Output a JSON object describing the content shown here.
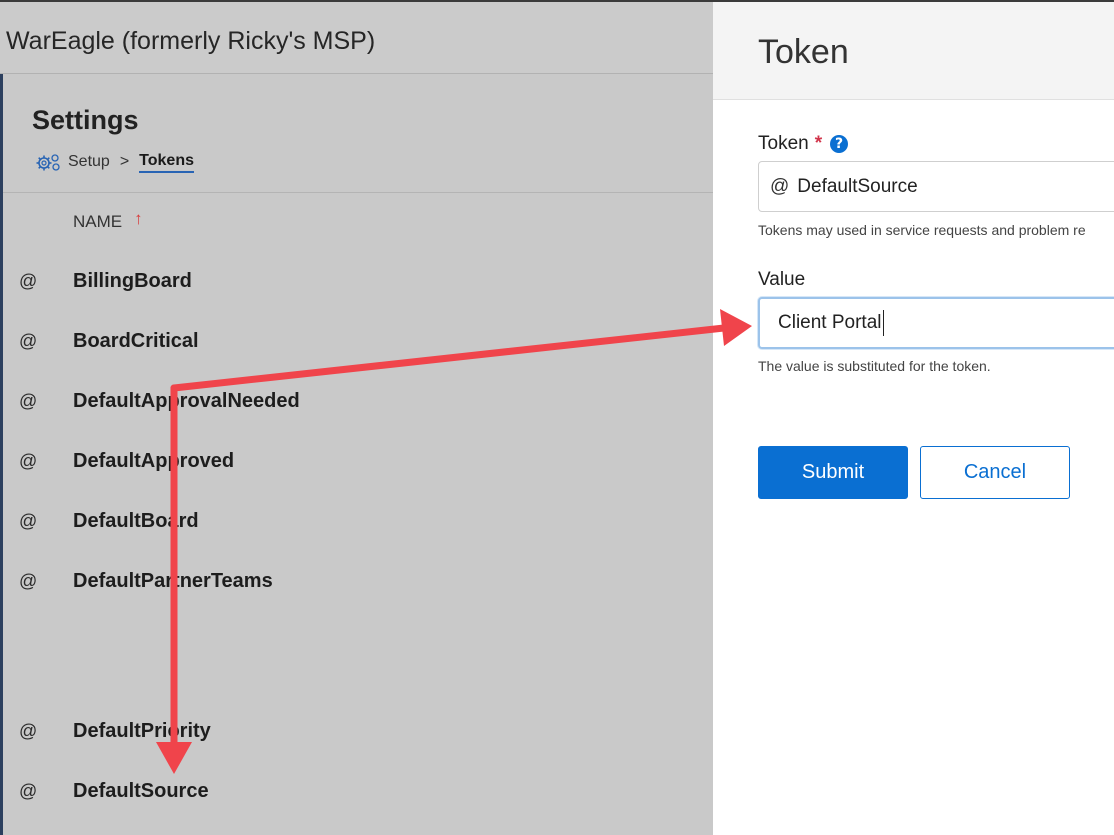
{
  "app": {
    "title": "WarEagle (formerly Ricky's MSP)"
  },
  "settings": {
    "page_title": "Settings",
    "breadcrumb": {
      "setup": "Setup",
      "separator": ">",
      "current": "Tokens"
    },
    "column_header": "NAME",
    "sort_icon": "sort-ascending-arrow",
    "tokens": [
      {
        "prefix": "@",
        "name": "BillingBoard"
      },
      {
        "prefix": "@",
        "name": "BoardCritical"
      },
      {
        "prefix": "@",
        "name": "DefaultApprovalNeeded"
      },
      {
        "prefix": "@",
        "name": "DefaultApproved"
      },
      {
        "prefix": "@",
        "name": "DefaultBoard"
      },
      {
        "prefix": "@",
        "name": "DefaultPartnerTeams"
      },
      {
        "prefix": "@",
        "name": "DefaultPriority"
      },
      {
        "prefix": "@",
        "name": "DefaultSource"
      }
    ]
  },
  "panel": {
    "title": "Token",
    "token_label": "Token",
    "required_mark": "*",
    "help_glyph": "?",
    "token_prefix": "@",
    "token_value": "DefaultSource",
    "token_help": "Tokens may used in service requests and problem re",
    "value_label": "Value",
    "value_value": "Client Portal",
    "value_help": "The value is substituted for the token.",
    "submit_label": "Submit",
    "cancel_label": "Cancel"
  },
  "colors": {
    "accent": "#0a6fd2",
    "annotation_arrow": "#f0444b",
    "required": "#d1344a",
    "sort_arrow": "#d83a3a"
  }
}
